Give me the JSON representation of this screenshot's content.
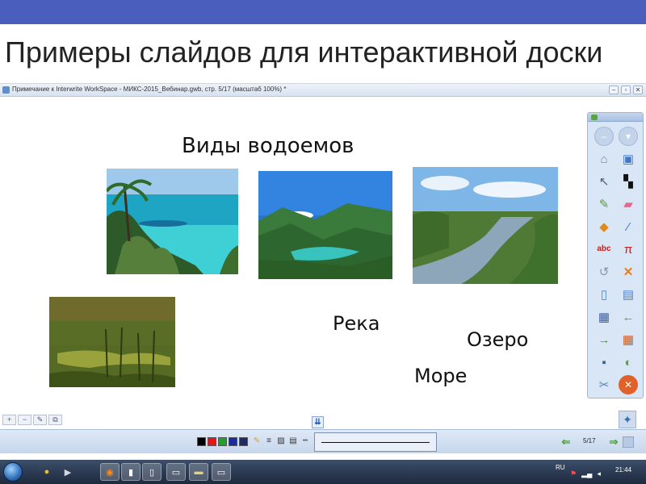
{
  "slide": {
    "title": "Примеры слайдов для интерактивной доски"
  },
  "window": {
    "title": "Примечание к Interwrite WorkSpace - МИКС-2015_Вебинар.gwb, стр. 5/17 (масштаб 100%) *",
    "controls": [
      "–",
      "▫",
      "✕"
    ]
  },
  "canvas": {
    "title": "Виды водоемов",
    "words": {
      "river": "Река",
      "lake": "Озеро",
      "sea": "Море"
    },
    "photos": [
      "sea-photo",
      "lake-photo",
      "river-photo",
      "swamp-photo"
    ]
  },
  "tool_panel": {
    "icons": [
      "minimize-icon",
      "collapse-icon",
      "mouse-icon",
      "page-icon",
      "pointer-icon",
      "selection-icon",
      "pen-icon",
      "eraser-icon",
      "shapes-icon",
      "line-icon",
      "text-icon",
      "math-icon",
      "undo-icon",
      "delete-icon",
      "new-page-icon",
      "page-copy-icon",
      "capture-icon",
      "back-icon",
      "forward-icon",
      "table-icon",
      "save-icon",
      "spotlight-icon",
      "settings-icon",
      "close-icon"
    ]
  },
  "bottom_toolbar": {
    "colors": [
      "#000000",
      "#e11818",
      "#1fa02a",
      "#1b2d9a",
      "#1f2a6a"
    ],
    "page_counter": "5/17"
  },
  "taskbar": {
    "language": "RU",
    "clock": "21:44"
  }
}
